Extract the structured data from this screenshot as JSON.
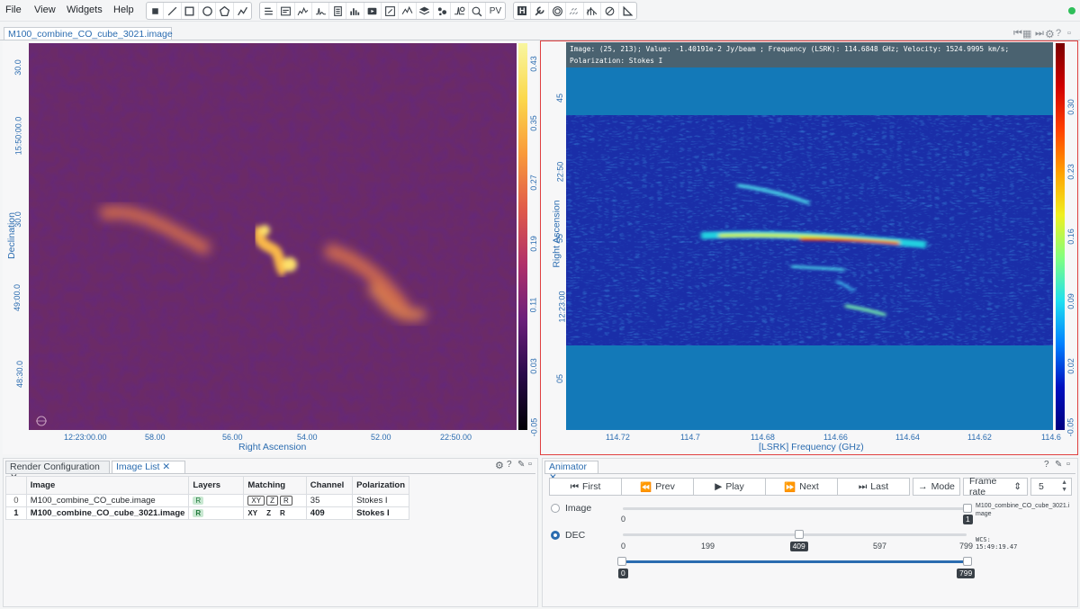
{
  "menu": {
    "file": "File",
    "view": "View",
    "widgets": "Widgets",
    "help": "Help"
  },
  "toolbar": {
    "pv_label": "PV",
    "h_label": "H"
  },
  "image_tab": {
    "title": "M100_combine_CO_cube_3021.image"
  },
  "left_view": {
    "x_title": "Right Ascension",
    "y_title": "Declination",
    "x_ticks": [
      "12:23:00.00",
      "58.00",
      "56.00",
      "54.00",
      "52.00",
      "22:50.00"
    ],
    "y_ticks": [
      "30.0",
      "15:50:00.0",
      "30.0",
      "49:00.0",
      "48:30.0"
    ],
    "colorbar_ticks": [
      "0.43",
      "0.35",
      "0.27",
      "0.19",
      "0.11",
      "0.03",
      "-0.05"
    ]
  },
  "right_view": {
    "cursor_line1": "Image: (25, 213); Value: -1.40191e-2 Jy/beam ; Frequency (LSRK): 114.6848 GHz; Velocity: 1524.9995 km/s;",
    "cursor_line2": "Polarization: Stokes I",
    "x_title": "[LSRK] Frequency (GHz)",
    "y_title": "Right Ascension",
    "x_ticks": [
      "114.72",
      "114.7",
      "114.68",
      "114.66",
      "114.64",
      "114.62",
      "114.6"
    ],
    "y_ticks": [
      "45",
      "22:50",
      "55",
      "12:23:00",
      "05"
    ],
    "colorbar_ticks": [
      "0.30",
      "0.23",
      "0.16",
      "0.09",
      "0.02",
      "-0.05"
    ]
  },
  "bottom_tabs": {
    "render": "Render Configuration",
    "imagelist": "Image List",
    "animator": "Animator"
  },
  "image_list": {
    "headers": {
      "image": "Image",
      "layers": "Layers",
      "matching": "Matching",
      "channel": "Channel",
      "polarization": "Polarization"
    },
    "rows": [
      {
        "index": "0",
        "image": "M100_combine_CO_cube.image",
        "layer": "R",
        "match": [
          "XY",
          "Z",
          "R"
        ],
        "channel": "35",
        "polarization": "Stokes I"
      },
      {
        "index": "1",
        "image": "M100_combine_CO_cube_3021.image",
        "layer": "R",
        "match": [
          "XY",
          "Z",
          "R"
        ],
        "channel": "409",
        "polarization": "Stokes I"
      }
    ]
  },
  "animator": {
    "first": "First",
    "prev": "Prev",
    "play": "Play",
    "next": "Next",
    "last": "Last",
    "mode": "Mode",
    "frame_rate": "Frame rate",
    "frame_rate_value": "5",
    "image_label": "Image",
    "image_min": "0",
    "image_value": "1",
    "image_name": "M100_combine_CO_cube_3021.image",
    "dec_label": "DEC",
    "dec_ticks": [
      "0",
      "199",
      "597",
      "799"
    ],
    "dec_value": "409",
    "dec_value_fraction": 0.512,
    "wcs_label": "WCS:",
    "wcs_value": "15:49:19.47",
    "range_min": "0",
    "range_max": "799"
  }
}
